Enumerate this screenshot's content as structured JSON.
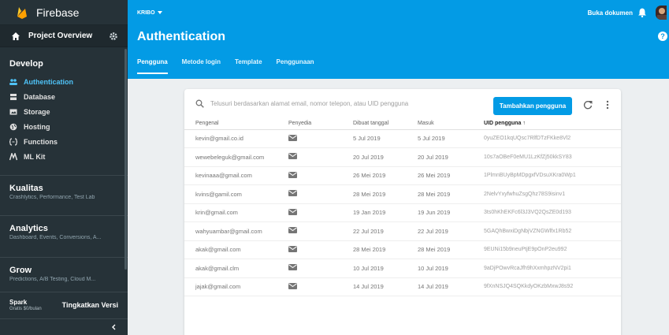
{
  "brand": "Firebase",
  "colors": {
    "accent": "#039be5",
    "sidebar": "#263238",
    "active_item": "#4fc3f7"
  },
  "sidebar": {
    "overview": "Project Overview",
    "develop_title": "Develop",
    "develop_items": [
      {
        "label": "Authentication",
        "icon": "people-icon"
      },
      {
        "label": "Database",
        "icon": "database-icon"
      },
      {
        "label": "Storage",
        "icon": "storage-icon"
      },
      {
        "label": "Hosting",
        "icon": "globe-icon"
      },
      {
        "label": "Functions",
        "icon": "functions-icon"
      },
      {
        "label": "ML Kit",
        "icon": "ml-kit-icon"
      }
    ],
    "groups": [
      {
        "title": "Kualitas",
        "subtitle": "Crashlytics, Performance, Test Lab"
      },
      {
        "title": "Analytics",
        "subtitle": "Dashboard, Events, Conversions, A..."
      },
      {
        "title": "Grow",
        "subtitle": "Predictions, A/B Testing, Cloud M..."
      }
    ],
    "plan_name": "Spark",
    "plan_price": "Gratis $0/bulan",
    "upgrade": "Tingkatkan Versi"
  },
  "header": {
    "project": "KRIBO",
    "docs_link": "Buka dokumen",
    "title": "Authentication",
    "help": "?",
    "tabs": [
      "Pengguna",
      "Metode login",
      "Template",
      "Penggunaan"
    ]
  },
  "users_card": {
    "search_placeholder": "Telusuri berdasarkan alamat email, nomor telepon, atau UID pengguna",
    "add_button": "Tambahkan pengguna",
    "columns": [
      "Pengenal",
      "Penyedia",
      "Dibuat tanggal",
      "Masuk",
      "UID pengguna"
    ],
    "sort_indicator": "↑",
    "rows": [
      {
        "id": "kevin@gmail.co.id",
        "created": "5 Jul 2019",
        "signed_in": "5 Jul 2019",
        "uid": "0yuZEO1kqUQsc7RlfDTzFKke8Vl2"
      },
      {
        "id": "wewebeleguk@gmail.com",
        "created": "20 Jul 2019",
        "signed_in": "20 Jul 2019",
        "uid": "10s7aOBeF0eMU1LzKfZj50kkSY83"
      },
      {
        "id": "kevinaaa@gmail.com",
        "created": "26 Mei 2019",
        "signed_in": "26 Mei 2019",
        "uid": "1PlmnBUyBpMDpgxfVDsuXKra0Wp1"
      },
      {
        "id": "kvins@gamil.com",
        "created": "28 Mei 2019",
        "signed_in": "28 Mei 2019",
        "uid": "2NelvYxyfwhuZsgQhz78S9isinv1"
      },
      {
        "id": "krin@gmail.com",
        "created": "19 Jan 2019",
        "signed_in": "19 Jun 2019",
        "uid": "3ts0hKhEKFc6l3J3VQ2QsZE0d193"
      },
      {
        "id": "wahyuambar@gmail.com",
        "created": "22 Jul 2019",
        "signed_in": "22 Jul 2019",
        "uid": "5GAQhBwxiDgNbjVZNGWlfx1Rb52"
      },
      {
        "id": "akak@gmail.com",
        "created": "28 Mei 2019",
        "signed_in": "28 Mei 2019",
        "uid": "9EUNi15b9neuPtjE9pOnP2eu992"
      },
      {
        "id": "akak@gmail.clm",
        "created": "10 Jul 2019",
        "signed_in": "10 Jul 2019",
        "uid": "9aDjPOwvRcaJfh9hXxmhpzNV2pi1"
      },
      {
        "id": "jajak@gmail.com",
        "created": "14 Jul 2019",
        "signed_in": "14 Jul 2019",
        "uid": "9fXnNSJQ4SQKkdyOKzbMxwJ8s92"
      }
    ]
  }
}
